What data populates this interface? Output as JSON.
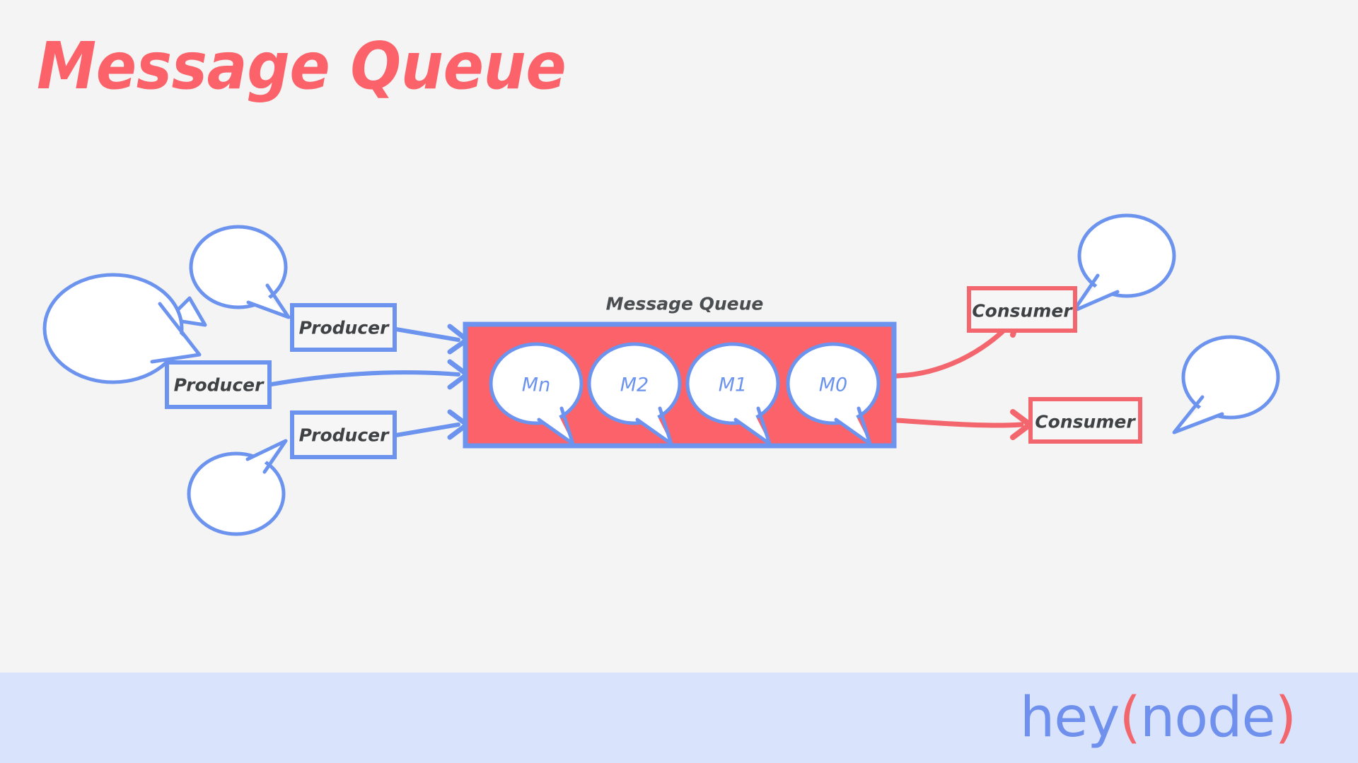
{
  "page": {
    "title": "Message Queue",
    "background_color": "#F4F4F4"
  },
  "colors": {
    "accent_red": "#FB6269",
    "accent_blue": "#6C93EE",
    "queue_fill": "#FB6269",
    "queue_border": "#6C93EE",
    "text_dark": "#3E4245",
    "banner_bg": "#D9E3FB",
    "bubble_fill": "#FFFFFF",
    "bubble_stroke": "#6C93EE"
  },
  "diagram": {
    "queue": {
      "caption": "Message Queue",
      "messages": [
        {
          "label": "Mn"
        },
        {
          "label": "M2"
        },
        {
          "label": "M1"
        },
        {
          "label": "M0"
        }
      ]
    },
    "producers": [
      {
        "label": "Producer"
      },
      {
        "label": "Producer"
      },
      {
        "label": "Producer"
      }
    ],
    "consumers": [
      {
        "label": "Consumer"
      },
      {
        "label": "Consumer"
      }
    ],
    "producer_bubbles": [
      {
        "name": "producer-bubble-top-left"
      },
      {
        "name": "producer-bubble-upper"
      },
      {
        "name": "producer-bubble-lower"
      }
    ],
    "consumer_bubbles": [
      {
        "name": "consumer-bubble-upper"
      },
      {
        "name": "consumer-bubble-lower"
      }
    ],
    "producer_arrows": 3,
    "consumer_arrows": 2
  },
  "banner": {
    "brand_part1": "hey",
    "brand_paren_open": "(",
    "brand_part2": "node",
    "brand_paren_close": ")"
  }
}
